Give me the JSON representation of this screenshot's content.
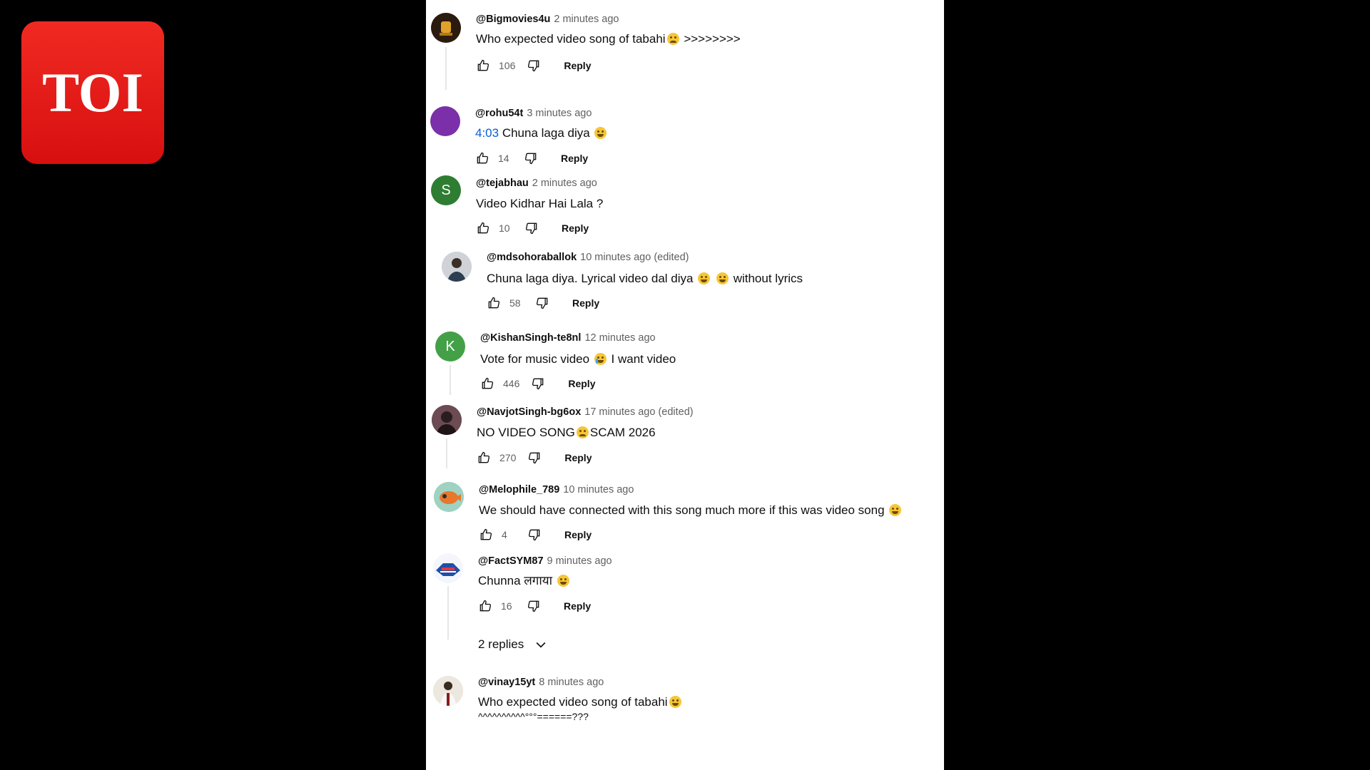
{
  "brand": {
    "logo_text": "TOI",
    "logo_color": "#e31b1b"
  },
  "comments": [
    {
      "handle": "@Bigmovies4u",
      "time": "2 minutes ago",
      "text_before": "Who expected video song of tabahi",
      "emoji": "sad",
      "text_after": ">>>>>>>>",
      "likes": "106",
      "reply_label": "Reply"
    },
    {
      "handle": "@rohu54t",
      "time": "3 minutes ago",
      "timestamp_link": "4:03",
      "text_before": "Chuna laga diya",
      "emoji": "grin",
      "likes": "14",
      "reply_label": "Reply",
      "avatar_color": "#7b2fa8"
    },
    {
      "handle": "@tejabhau",
      "time": "2 minutes ago",
      "text_before": "Video Kidhar Hai Lala ?",
      "likes": "10",
      "reply_label": "Reply",
      "avatar_letter": "S",
      "avatar_color": "#2e7d32"
    },
    {
      "handle": "@mdsohoraballok",
      "time": "10 minutes ago (edited)",
      "text_before": "Chuna laga diya. Lyrical video dal diya",
      "emoji": "grin",
      "emoji2": "grin",
      "text_after": "without lyrics",
      "likes": "58",
      "reply_label": "Reply"
    },
    {
      "handle": "@KishanSingh-te8nl",
      "time": "12 minutes ago",
      "text_before": "Vote for music video",
      "emoji": "cry",
      "text_after": "I want video",
      "likes": "446",
      "reply_label": "Reply",
      "avatar_letter": "K",
      "avatar_color": "#43a047"
    },
    {
      "handle": "@NavjotSingh-bg6ox",
      "time": "17 minutes ago (edited)",
      "text_before": "NO VIDEO SONG",
      "emoji": "sad",
      "text_after": "SCAM 2026",
      "likes": "270",
      "reply_label": "Reply"
    },
    {
      "handle": "@Melophile_789",
      "time": "10 minutes ago",
      "text_before": "We should have connected with this song much more if this was video song",
      "emoji": "grin",
      "likes": "4",
      "reply_label": "Reply"
    },
    {
      "handle": "@FactSYM87",
      "time": "9 minutes ago",
      "text_before": "Chunna लगाया",
      "emoji": "grin",
      "likes": "16",
      "reply_label": "Reply",
      "replies_label": "2 replies"
    },
    {
      "handle": "@vinay15yt",
      "time": "8 minutes ago",
      "text_before": "Who expected video song of tabahi",
      "emoji": "smile",
      "text_cont": "^^^^^^^^^^°°°======???"
    }
  ]
}
